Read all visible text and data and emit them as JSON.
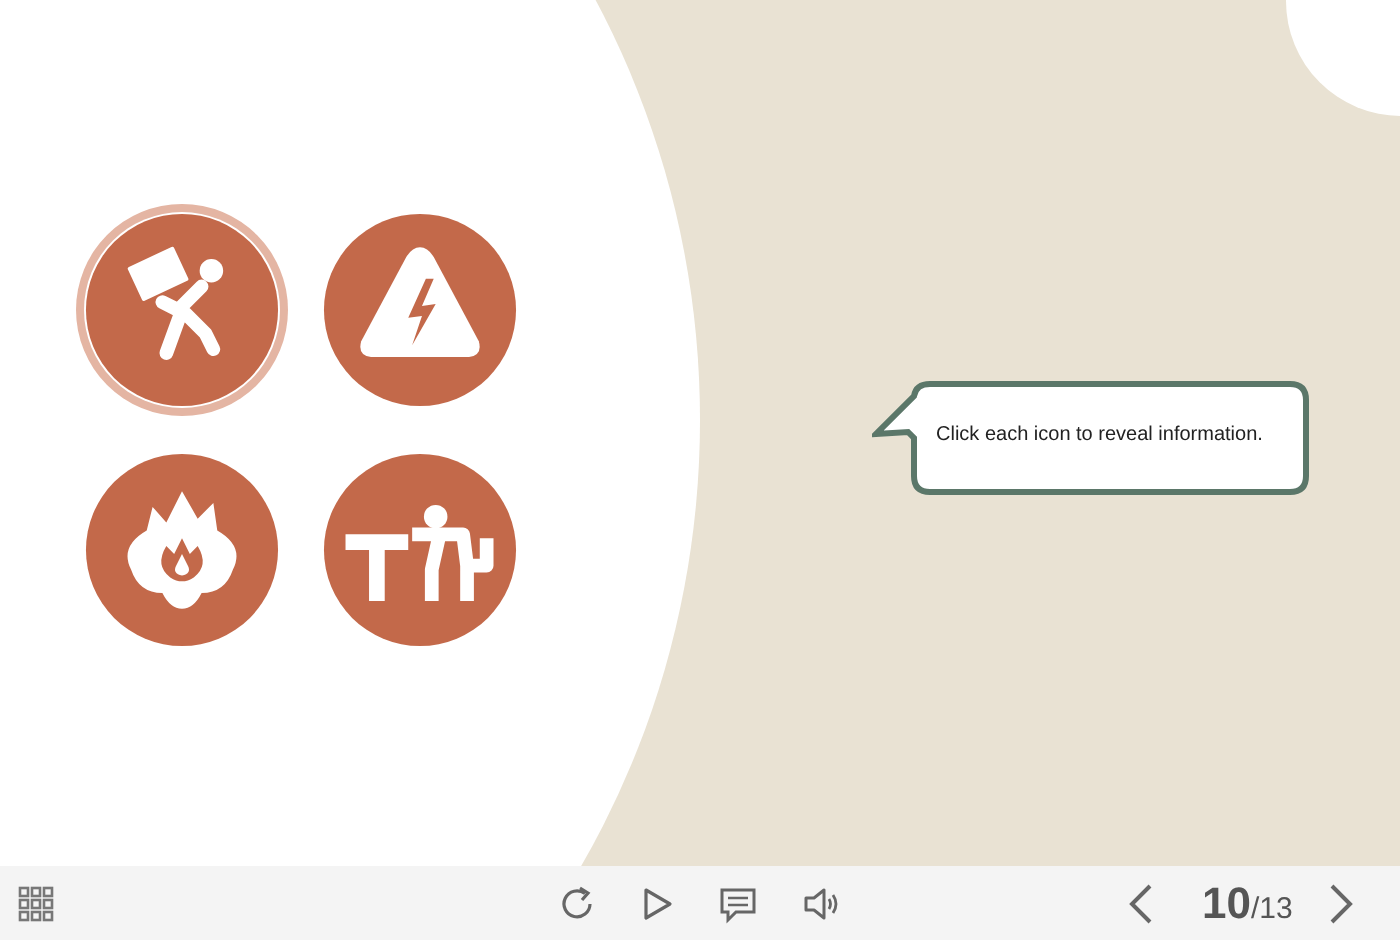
{
  "icons": [
    {
      "kind": "carrying",
      "selected": true
    },
    {
      "kind": "electric",
      "selected": false
    },
    {
      "kind": "fire",
      "selected": false
    },
    {
      "kind": "lifting",
      "selected": false
    }
  ],
  "callout": {
    "text": "Click each icon to reveal information."
  },
  "toolbar": {
    "page_current": "10",
    "page_total": "/13"
  }
}
